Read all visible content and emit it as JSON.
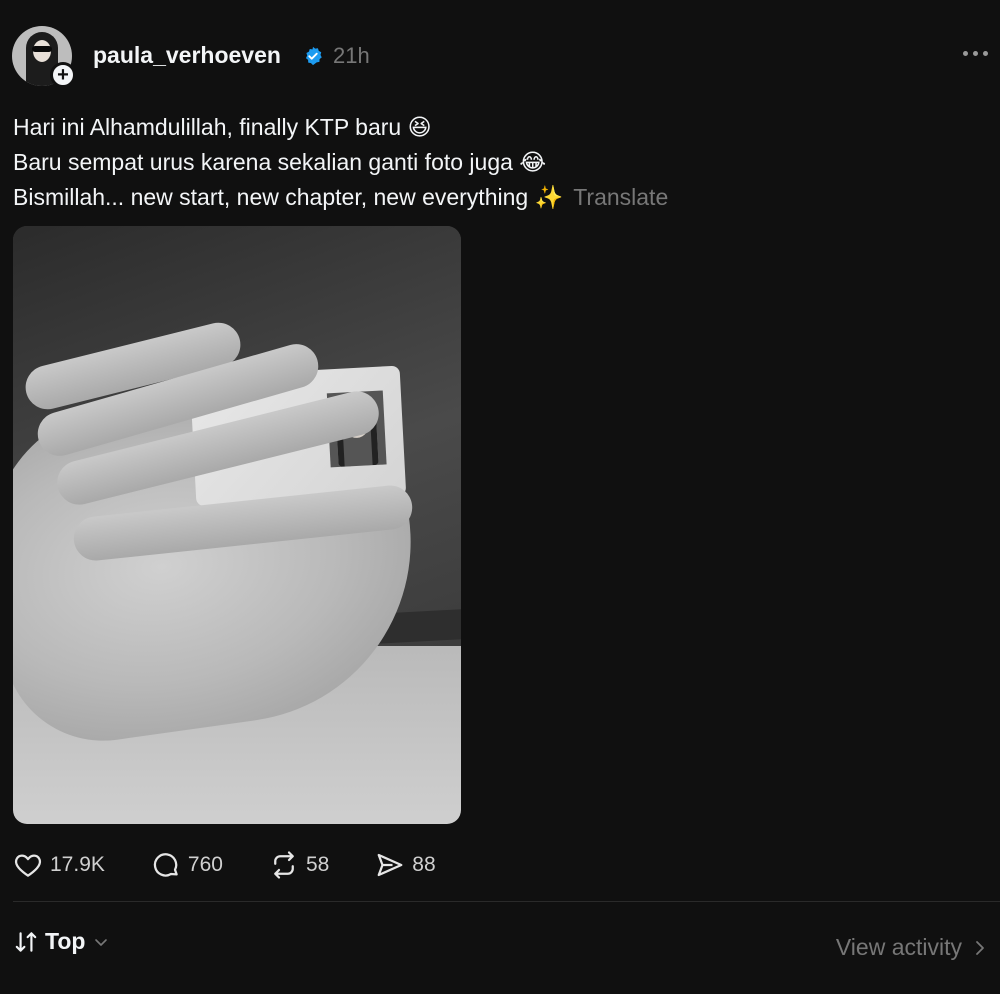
{
  "post": {
    "username": "paula_verhoeven",
    "time": "21h",
    "caption_lines": [
      "Hari ini Alhamdulillah, finally KTP baru 😆",
      "Baru sempat urus karena sekalian ganti foto juga 😂",
      "Bismillah... new start, new chapter, new everything ✨"
    ],
    "translate_label": "Translate"
  },
  "icons": {
    "verified": "verified-badge-icon",
    "more": "more-options-icon",
    "like": "heart-icon",
    "comment": "comment-bubble-icon",
    "repost": "repost-icon",
    "share": "send-icon",
    "sort": "sort-arrows-icon",
    "chevron": "chevron-down-icon",
    "activity_chevron": "chevron-right-icon"
  },
  "colors": {
    "background": "#101010",
    "text": "#f3f5f7",
    "muted": "#777777",
    "verified": "#1d9bf0"
  },
  "actions": {
    "likes": "17.9K",
    "comments": "760",
    "reposts": "58",
    "shares": "88"
  },
  "footer": {
    "sort_label": "Top",
    "activity_label": "View activity"
  }
}
